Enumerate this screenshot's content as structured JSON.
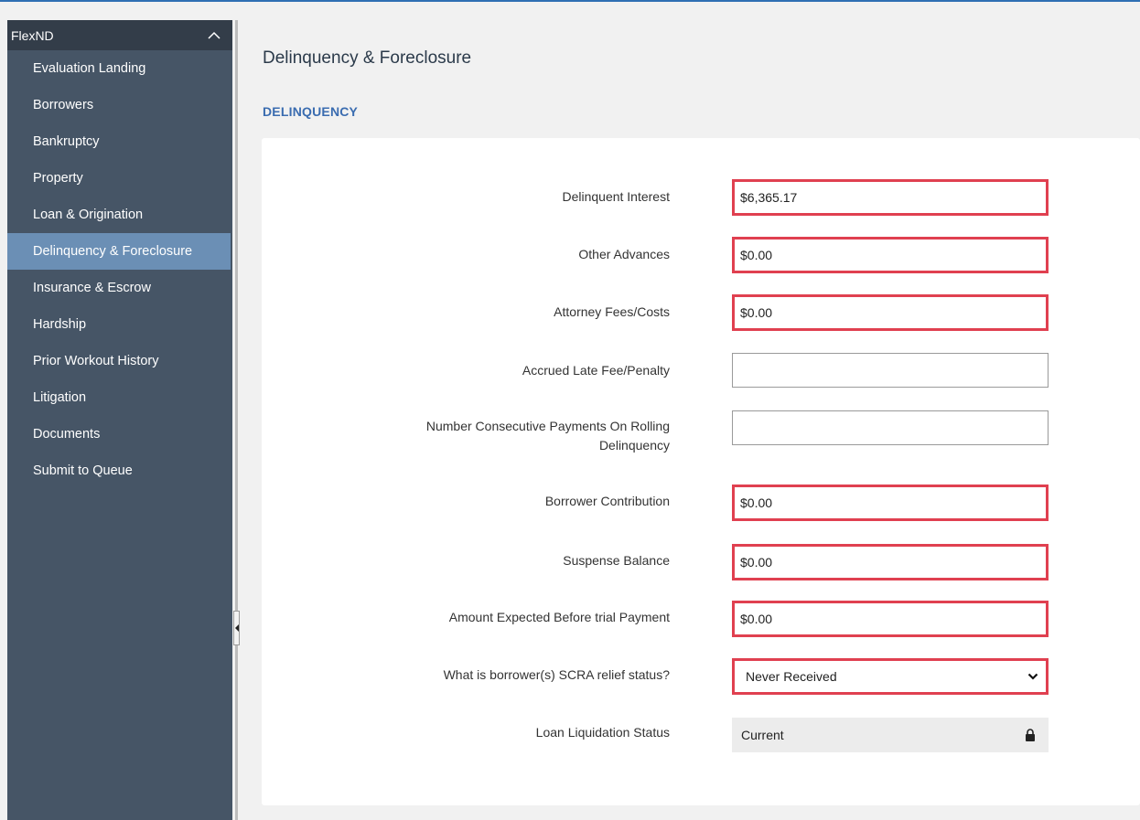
{
  "sidebar": {
    "title": "FlexND",
    "items": [
      {
        "label": "Evaluation Landing"
      },
      {
        "label": "Borrowers"
      },
      {
        "label": "Bankruptcy"
      },
      {
        "label": "Property"
      },
      {
        "label": "Loan & Origination"
      },
      {
        "label": "Delinquency & Foreclosure",
        "active": true
      },
      {
        "label": "Insurance & Escrow"
      },
      {
        "label": "Hardship"
      },
      {
        "label": "Prior Workout History"
      },
      {
        "label": "Litigation"
      },
      {
        "label": "Documents"
      },
      {
        "label": "Submit to Queue"
      }
    ]
  },
  "page": {
    "title": "Delinquency & Foreclosure",
    "section": "DELINQUENCY"
  },
  "form": {
    "delinquent_interest": {
      "label": "Delinquent Interest",
      "value": "$6,365.17"
    },
    "other_advances": {
      "label": "Other Advances",
      "value": "$0.00"
    },
    "attorney_fees": {
      "label": "Attorney Fees/Costs",
      "value": "$0.00"
    },
    "accrued_late_fee": {
      "label": "Accrued Late Fee/Penalty",
      "value": ""
    },
    "consecutive_payments": {
      "label_line1": "Number Consecutive Payments On Rolling",
      "label_line2": "Delinquency",
      "value": ""
    },
    "borrower_contribution": {
      "label": "Borrower Contribution",
      "value": "$0.00"
    },
    "suspense_balance": {
      "label": "Suspense Balance",
      "value": "$0.00"
    },
    "amount_expected": {
      "label": "Amount Expected Before trial Payment",
      "value": "$0.00"
    },
    "scra_status": {
      "label": "What is borrower(s) SCRA relief status?",
      "value": "Never Received"
    },
    "loan_liquidation": {
      "label": "Loan Liquidation Status",
      "value": "Current"
    }
  },
  "colors": {
    "sidebar_bg": "#465566",
    "sidebar_active": "#6b8fb5",
    "highlight_border": "#e04050",
    "section_title": "#3a6cb0"
  },
  "icons": {
    "header_toggle": "chevron-up-icon",
    "locked_field": "lock-icon",
    "select_arrow": "chevron-down-icon",
    "collapse": "collapse-left-icon"
  }
}
